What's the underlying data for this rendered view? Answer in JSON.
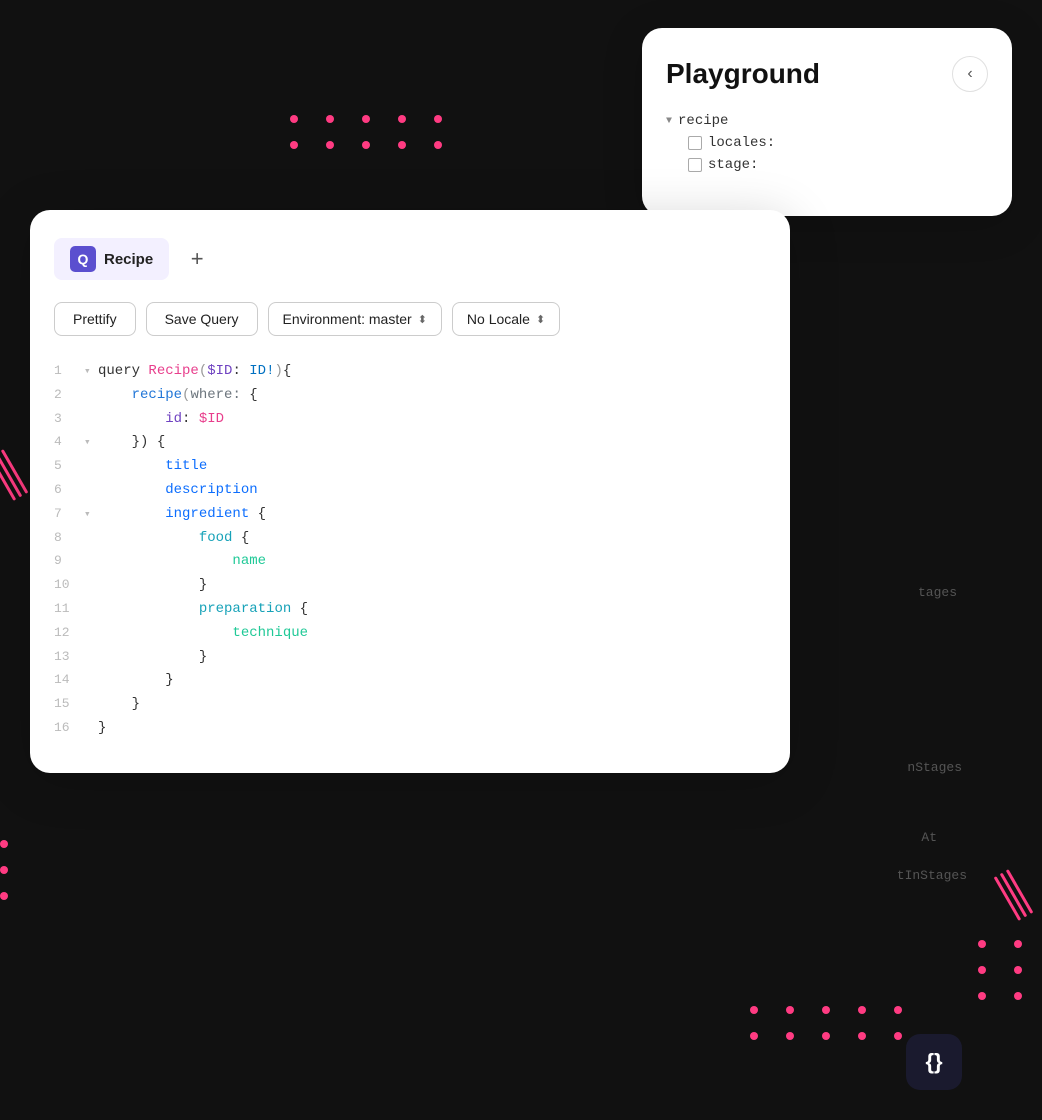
{
  "playground": {
    "title": "Playground",
    "close_btn": "‹",
    "tree": {
      "root": "recipe",
      "children": [
        {
          "label": "locales:",
          "checked": false
        },
        {
          "label": "stage:",
          "checked": false
        }
      ]
    }
  },
  "editor": {
    "tab": {
      "icon": "Q",
      "label": "Recipe"
    },
    "add_tab_label": "+",
    "toolbar": {
      "prettify": "Prettify",
      "save_query": "Save Query",
      "environment": "Environment: master",
      "locale": "No Locale"
    },
    "code_lines": [
      {
        "num": "1",
        "arrow": "▾",
        "content": "query Recipe($ID: ID!){"
      },
      {
        "num": "2",
        "arrow": "",
        "content": "    recipe(where: {"
      },
      {
        "num": "3",
        "arrow": "",
        "content": "        id: $ID"
      },
      {
        "num": "4",
        "arrow": "▾",
        "content": "    }) {"
      },
      {
        "num": "5",
        "arrow": "",
        "content": "        title"
      },
      {
        "num": "6",
        "arrow": "",
        "content": "        description"
      },
      {
        "num": "7",
        "arrow": "▾",
        "content": "        ingredient {"
      },
      {
        "num": "8",
        "arrow": "",
        "content": "            food {"
      },
      {
        "num": "9",
        "arrow": "",
        "content": "                name"
      },
      {
        "num": "10",
        "arrow": "",
        "content": "            }"
      },
      {
        "num": "11",
        "arrow": "",
        "content": "            preparation {"
      },
      {
        "num": "12",
        "arrow": "",
        "content": "                technique"
      },
      {
        "num": "13",
        "arrow": "",
        "content": "            }"
      },
      {
        "num": "14",
        "arrow": "",
        "content": "        }"
      },
      {
        "num": "15",
        "arrow": "",
        "content": "    }"
      },
      {
        "num": "16",
        "arrow": "",
        "content": "}"
      }
    ]
  },
  "bottom_icon": {
    "symbol": "{}"
  },
  "partial_texts": {
    "stages1": "tages",
    "stages2": "nStages",
    "at": "At",
    "instages": "tInStages"
  },
  "dots": {
    "color": "#ff3b82"
  }
}
